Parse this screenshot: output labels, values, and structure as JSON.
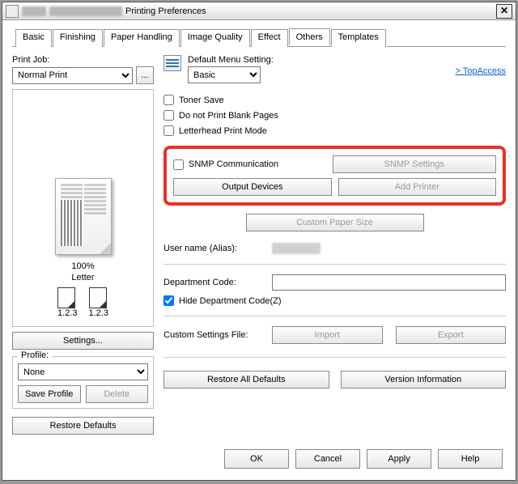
{
  "window": {
    "title": "Printing Preferences"
  },
  "tabs": [
    "Basic",
    "Finishing",
    "Paper Handling",
    "Image Quality",
    "Effect",
    "Others",
    "Templates"
  ],
  "active_tab": "Others",
  "left": {
    "print_job_label": "Print Job:",
    "print_job_value": "Normal Print",
    "more_btn": "...",
    "zoom": "100%",
    "paper": "Letter",
    "stack_caption": "1.2.3",
    "settings_btn": "Settings...",
    "profile_label": "Profile:",
    "profile_value": "None",
    "save_profile": "Save Profile",
    "delete": "Delete",
    "restore": "Restore Defaults"
  },
  "right": {
    "default_menu_label": "Default Menu Setting:",
    "default_menu_value": "Basic",
    "topaccess": "> TopAccess",
    "toner_save": "Toner Save",
    "blank_pages": "Do not Print Blank Pages",
    "letterhead": "Letterhead Print Mode",
    "snmp_comm": "SNMP Communication",
    "snmp_settings": "SNMP Settings",
    "output_devices": "Output Devices",
    "add_printer": "Add Printer",
    "custom_paper": "Custom Paper Size",
    "alias_label": "User name (Alias):",
    "dept_label": "Department Code:",
    "hide_dept": "Hide Department Code(Z)",
    "custom_file": "Custom Settings File:",
    "import": "Import",
    "export": "Export",
    "restore_all": "Restore All Defaults",
    "version": "Version Information"
  },
  "footer": {
    "ok": "OK",
    "cancel": "Cancel",
    "apply": "Apply",
    "help": "Help"
  }
}
